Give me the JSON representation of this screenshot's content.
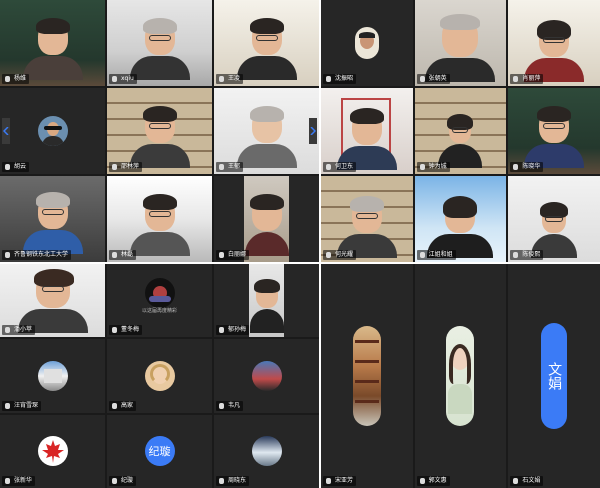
{
  "window_1": {
    "tiles": [
      {
        "name": "杨维"
      },
      {
        "name": "xqiu"
      },
      {
        "name": "王凌"
      },
      {
        "name": "胡云"
      },
      {
        "name": "邵林萍"
      },
      {
        "name": "王郁"
      },
      {
        "name": "齐鲁钢铁东北工大学"
      },
      {
        "name": "林磊"
      },
      {
        "name": "白丽娜"
      }
    ]
  },
  "window_2": {
    "tiles": [
      {
        "name": "沈振昭"
      },
      {
        "name": "张朝英"
      },
      {
        "name": "肖丽萍"
      },
      {
        "name": "何卫东"
      },
      {
        "name": "钟为城"
      },
      {
        "name": "陈晓华"
      },
      {
        "name": "何光耀"
      },
      {
        "name": "江姐和姐"
      },
      {
        "name": "陈俊熙"
      }
    ]
  },
  "window_3": {
    "tiles": [
      {
        "name": "潘小苹"
      },
      {
        "name": "董冬梅",
        "avatar_label": "以这届再度精彩"
      },
      {
        "name": "郁孙梅"
      },
      {
        "name": "汪宵雪琛"
      },
      {
        "name": "高家"
      },
      {
        "name": "韦凡"
      },
      {
        "name": "张新华"
      },
      {
        "name": "纪璇",
        "avatar_text": "纪璇"
      },
      {
        "name": "周晓东"
      }
    ]
  },
  "window_4": {
    "tiles": [
      {
        "name": "宋亚芳"
      },
      {
        "name": "郭文惠"
      },
      {
        "name": "石文娟",
        "avatar_text": "文娟"
      }
    ]
  },
  "colors": {
    "active_speaker": "#5acb5a",
    "avatar_blue": "#3b7bf6",
    "background": "#1a1a1a"
  },
  "icons": {
    "nav_prev": "chevron-left-icon",
    "nav_next": "chevron-right-icon",
    "mic": "mic-icon"
  }
}
